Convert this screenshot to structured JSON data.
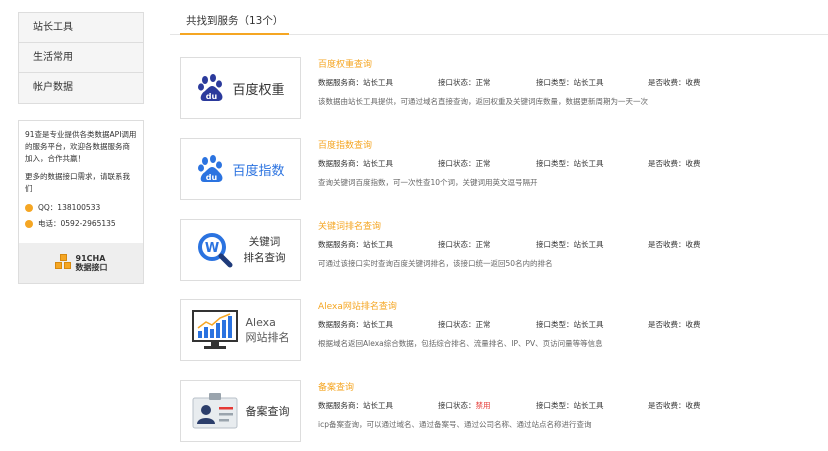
{
  "sidebar": {
    "menu": [
      "站长工具",
      "生活常用",
      "帐户数据"
    ],
    "intro": "91查是专业提供各类数据API调用的服务平台，欢迎各数据服务商加入，合作共赢！",
    "more": "更多的数据接口需求，请联系我们",
    "qq": "QQ：138100533",
    "phone": "电话：0592-2965135",
    "logo_line1": "91CHA",
    "logo_line2": "数据接口"
  },
  "header": {
    "tab": "共找到服务（13个）"
  },
  "services": [
    {
      "title": "百度权重查询",
      "provider": "数据服务商：站长工具",
      "status_label": "接口状态：",
      "status": "正常",
      "type": "接口类型：站长工具",
      "fee": "是否收费：收费",
      "desc": "该数据由站长工具提供，可通过域名直接查询，返回权重及关键词库数量，数据更新周期为一天一次",
      "thumb_label": "百度权重",
      "icon": "baidu-paw-icon"
    },
    {
      "title": "百度指数查询",
      "provider": "数据服务商：站长工具",
      "status_label": "接口状态：",
      "status": "正常",
      "type": "接口类型：站长工具",
      "fee": "是否收费：收费",
      "desc": "查询关键词百度指数，可一次性查10个词，关键词用英文逗号隔开",
      "thumb_label": "百度指数",
      "icon": "baidu-paw-icon"
    },
    {
      "title": "关键词排名查询",
      "provider": "数据服务商：站长工具",
      "status_label": "接口状态：",
      "status": "正常",
      "type": "接口类型：站长工具",
      "fee": "是否收费：收费",
      "desc": "可通过该接口实时查询百度关键词排名，该接口统一返回50名内的排名",
      "thumb_label_1": "关键词",
      "thumb_label_2": "排名查询",
      "icon": "w-magnifier-icon"
    },
    {
      "title": "Alexa网站排名查询",
      "provider": "数据服务商：站长工具",
      "status_label": "接口状态：",
      "status": "正常",
      "type": "接口类型：站长工具",
      "fee": "是否收费：收费",
      "desc": "根据域名返回Alexa综合数据，包括综合排名、流量排名、IP、PV、页访问量等等信息",
      "thumb_label_1": "Alexa",
      "thumb_label_2": "网站排名",
      "icon": "monitor-chart-icon"
    },
    {
      "title": "备案查询",
      "provider": "数据服务商：站长工具",
      "status_label": "接口状态：",
      "status": "禁用",
      "type": "接口类型：站长工具",
      "fee": "是否收费：收费",
      "desc": "icp备案查询，可以通过域名、通过备案号、通过公司名称、通过站点名称进行查询",
      "thumb_label": "备案查询",
      "icon": "id-card-icon"
    }
  ],
  "colors": {
    "accent": "#f5a623",
    "disabled": "#e53935",
    "baidu_blue": "#2b73e0"
  }
}
